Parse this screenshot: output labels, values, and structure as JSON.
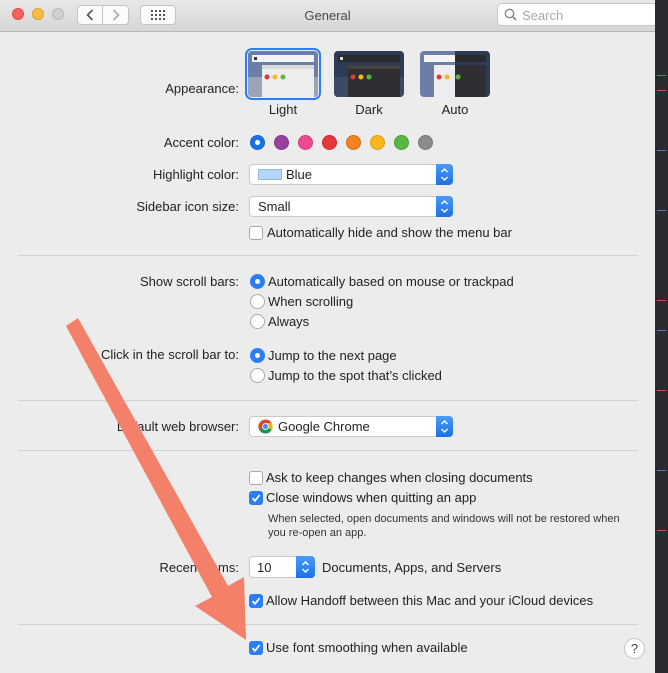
{
  "window": {
    "title": "General"
  },
  "search": {
    "placeholder": "Search"
  },
  "appearance": {
    "label": "Appearance:",
    "options": [
      {
        "name": "Light",
        "selected": true
      },
      {
        "name": "Dark",
        "selected": false
      },
      {
        "name": "Auto",
        "selected": false
      }
    ]
  },
  "accent": {
    "label": "Accent color:",
    "colors": [
      "#1a72e8",
      "#9b3fa0",
      "#ee4a92",
      "#e5383b",
      "#f5811f",
      "#f8b81c",
      "#5cb644",
      "#8c8c8c"
    ],
    "selected_index": 0
  },
  "highlight": {
    "label": "Highlight color:",
    "value": "Blue",
    "swatch": "#b4d5fe"
  },
  "sidebar_icon": {
    "label": "Sidebar icon size:",
    "value": "Small"
  },
  "menu_bar": {
    "label": "Automatically hide and show the menu bar",
    "checked": false
  },
  "scroll_bars": {
    "label": "Show scroll bars:",
    "options": [
      {
        "label": "Automatically based on mouse or trackpad",
        "selected": true
      },
      {
        "label": "When scrolling",
        "selected": false
      },
      {
        "label": "Always",
        "selected": false
      }
    ]
  },
  "scroll_click": {
    "label": "Click in the scroll bar to:",
    "options": [
      {
        "label": "Jump to the next page",
        "selected": true
      },
      {
        "label": "Jump to the spot that’s clicked",
        "selected": false
      }
    ]
  },
  "browser": {
    "label": "Default web browser:",
    "value": "Google Chrome"
  },
  "ask_keep": {
    "label": "Ask to keep changes when closing documents",
    "checked": false
  },
  "close_windows": {
    "label": "Close windows when quitting an app",
    "checked": true
  },
  "close_note": "When selected, open documents and windows will not be restored when you re-open an app.",
  "recent": {
    "label": "Recent items:",
    "value": "10",
    "suffix": "Documents, Apps, and Servers"
  },
  "handoff": {
    "label": "Allow Handoff between this Mac and your iCloud devices",
    "checked": true
  },
  "font_smoothing": {
    "label": "Use font smoothing when available",
    "checked": true
  },
  "help": {
    "label": "?"
  },
  "annotation": {
    "color": "#f4806a"
  }
}
